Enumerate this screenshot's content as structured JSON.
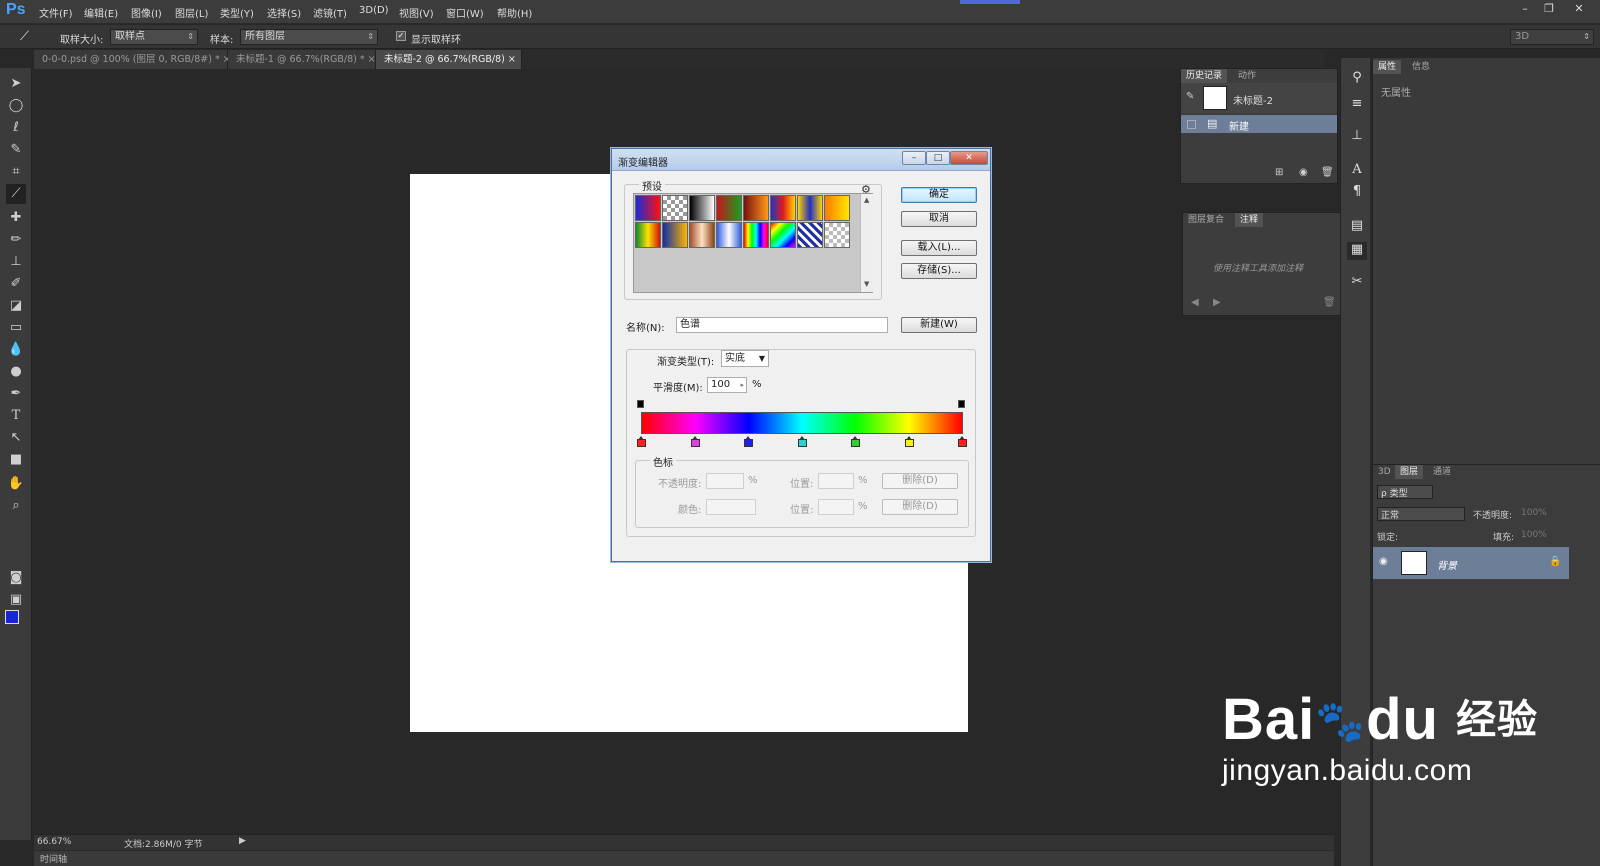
{
  "app": {
    "logo": "Ps"
  },
  "menu": [
    "文件(F)",
    "编辑(E)",
    "图像(I)",
    "图层(L)",
    "类型(Y)",
    "选择(S)",
    "滤镜(T)",
    "3D(D)",
    "视图(V)",
    "窗口(W)",
    "帮助(H)"
  ],
  "window_buttons": [
    "–",
    "❐",
    "✕"
  ],
  "options": {
    "sample_size_label": "取样大小:",
    "sample_size_value": "取样点",
    "sample_label": "样本:",
    "sample_value": "所有图层",
    "show_ring_label": "显示取样环",
    "workspace": "3D"
  },
  "doc_tabs": [
    {
      "label": "0-0-0.psd @ 100% (图层 0, RGB/8#) *",
      "close": "×"
    },
    {
      "label": "未标题-1 @ 66.7%(RGB/8) *",
      "close": "×"
    },
    {
      "label": "未标题-2 @ 66.7%(RGB/8)",
      "close": "×"
    }
  ],
  "status": {
    "zoom": "66.67%",
    "doc": "文档:2.86M/0 字节",
    "timeline": "时间轴"
  },
  "history_panel": {
    "tabs": [
      "历史记录",
      "动作"
    ],
    "snapshot": "未标题-2",
    "step": "新建"
  },
  "notes_panel": {
    "tabs": [
      "图层复合",
      "注释"
    ],
    "hint": "使用注释工具添加注释"
  },
  "properties_panel": {
    "tabs": [
      "属性",
      "信息"
    ],
    "text": "无属性"
  },
  "layers_panel": {
    "tabs": [
      "3D",
      "图层",
      "通道"
    ],
    "kind": "ρ 类型",
    "blend": "正常",
    "opacity_label": "不透明度:",
    "opacity": "100%",
    "lock_label": "锁定:",
    "fill_label": "填充:",
    "fill": "100%",
    "layer_name": "背景"
  },
  "dialog": {
    "title": "渐变编辑器",
    "presets_label": "预设",
    "ok": "确定",
    "cancel": "取消",
    "load": "载入(L)...",
    "save": "存储(S)...",
    "name_label": "名称(N):",
    "name_value": "色谱",
    "new_button": "新建(W)",
    "gradient_type_label": "渐变类型(T):",
    "gradient_type_value": "实底",
    "smoothness_label": "平滑度(M):",
    "smoothness_value": "100",
    "smoothness_unit": "%",
    "stops_group_label": "色标",
    "opacity_label": "不透明度:",
    "color_label": "颜色:",
    "location_label": "位置:",
    "percent": "%",
    "delete_label": "删除(D)",
    "presets": [
      "linear-gradient(to right,#1a2bd8,#ff1010)",
      "repeating-conic-gradient(#999 0 25%,#fff 0 50%) 0 0/8px 8px",
      "linear-gradient(to right,#000,#fff)",
      "linear-gradient(to right,#c3161b,#16a020)",
      "linear-gradient(to right,#7a1010,#ff9a1a)",
      "linear-gradient(to right,#2533c8,#e01b1b,#ffd200)",
      "linear-gradient(to right,#ffd200,#2030c0,#ffd200)",
      "linear-gradient(to right,#ff7a00,#ffe800)",
      "linear-gradient(to right,#0b8a2a,#ffe400,#d01010)",
      "linear-gradient(to right,#0f2fa8,#ffb400)",
      "linear-gradient(to right,#a0522d,#ffe0c8,#8b4513)",
      "linear-gradient(to right,#3060e0,#fff,#3060e0)",
      "linear-gradient(to right,#f00,#ff0,#0f0,#0ff,#00f,#f0f,#f00)",
      "linear-gradient(135deg,#f00,#ff0,#0f0,#0ff,#00f,#f0f)",
      "repeating-linear-gradient(45deg,#2030a0 0 3px,#fff 3px 6px)",
      "repeating-conic-gradient(#bbb 0 25%,#fff 0 50%) 0 0/8px 8px"
    ],
    "gradient": [
      "#ff0000",
      "#ff00ff",
      "#0000ff",
      "#00ffff",
      "#00ff00",
      "#ffff00",
      "#ff0000"
    ],
    "color_stops": [
      "#ff2020",
      "#e040e0",
      "#2020e0",
      "#30d0d0",
      "#30d030",
      "#f0f020",
      "#ff2020"
    ]
  },
  "watermark": {
    "brand": "Bai",
    "brand2": "du",
    "cn": "经验",
    "url": "jingyan.baidu.com"
  }
}
